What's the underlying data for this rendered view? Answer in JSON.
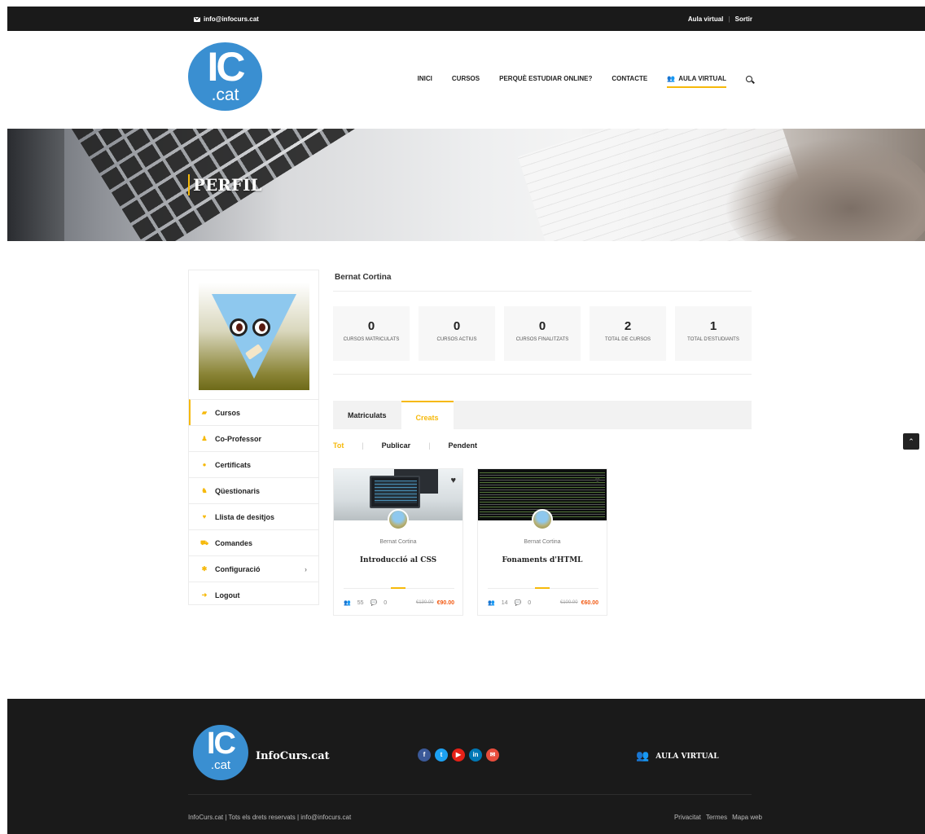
{
  "topbar": {
    "email": "info@infocurs.cat",
    "aula_virtual": "Aula virtual",
    "sortir": "Sortir"
  },
  "header": {
    "logo_big": "IC",
    "logo_small": ".cat",
    "nav": [
      "INICI",
      "CURSOS",
      "PERQUÈ ESTUDIAR ONLINE?",
      "CONTACTE"
    ],
    "nav_active": "AULA VIRTUAL"
  },
  "hero": {
    "title": "PERFIL"
  },
  "profile": {
    "name": "Bernat Cortina",
    "stats": [
      {
        "value": "0",
        "label": "CURSOS MATRICULATS"
      },
      {
        "value": "0",
        "label": "CURSOS ACTIUS"
      },
      {
        "value": "0",
        "label": "CURSOS FINALITZATS"
      },
      {
        "value": "2",
        "label": "TOTAL DE CURSOS"
      },
      {
        "value": "1",
        "label": "TOTAL D'ESTUDIANTS"
      }
    ]
  },
  "menu": [
    {
      "label": "Cursos",
      "icon": "book-icon"
    },
    {
      "label": "Co-Professor",
      "icon": "user-icon"
    },
    {
      "label": "Certificats",
      "icon": "certificate-icon"
    },
    {
      "label": "Qüestionaris",
      "icon": "quiz-icon"
    },
    {
      "label": "Llista de desitjos",
      "icon": "heart-icon"
    },
    {
      "label": "Comandes",
      "icon": "cart-icon"
    },
    {
      "label": "Configuració",
      "icon": "gear-icon"
    },
    {
      "label": "Logout",
      "icon": "logout-icon"
    }
  ],
  "tabs": {
    "matriculats": "Matriculats",
    "creats": "Creats"
  },
  "filters": {
    "tot": "Tot",
    "publicar": "Publicar",
    "pendent": "Pendent"
  },
  "courses": [
    {
      "author": "Bernat Cortina",
      "title": "Introducció al CSS",
      "students": "55",
      "comments": "0",
      "old_price": "€130.00",
      "price": "€90.00"
    },
    {
      "author": "Bernat Cortina",
      "title": "Fonaments d'HTML",
      "students": "14",
      "comments": "0",
      "old_price": "€100.00",
      "price": "€60.00"
    }
  ],
  "footer": {
    "logo_big": "IC",
    "logo_small": ".cat",
    "site_name": "InfoCurs.cat",
    "aula_virtual": "AULA VIRTUAL",
    "copyright": "InfoCurs.cat | Tots els drets reservats | info@infocurs.cat",
    "links": [
      "Privacitat",
      "Termes",
      "Mapa web"
    ],
    "social": [
      {
        "name": "facebook-icon",
        "glyph": "f",
        "color": "#3b5998"
      },
      {
        "name": "twitter-icon",
        "glyph": "t",
        "color": "#1da1f2"
      },
      {
        "name": "youtube-icon",
        "glyph": "▶",
        "color": "#e62117"
      },
      {
        "name": "linkedin-icon",
        "glyph": "in",
        "color": "#0077b5"
      },
      {
        "name": "email-icon",
        "glyph": "✉",
        "color": "#e74c3c"
      }
    ]
  },
  "colors": {
    "accent": "#f6b90b",
    "price": "#f25a13",
    "brand_blue": "#3a8fd1",
    "dark": "#1a1a1a"
  }
}
